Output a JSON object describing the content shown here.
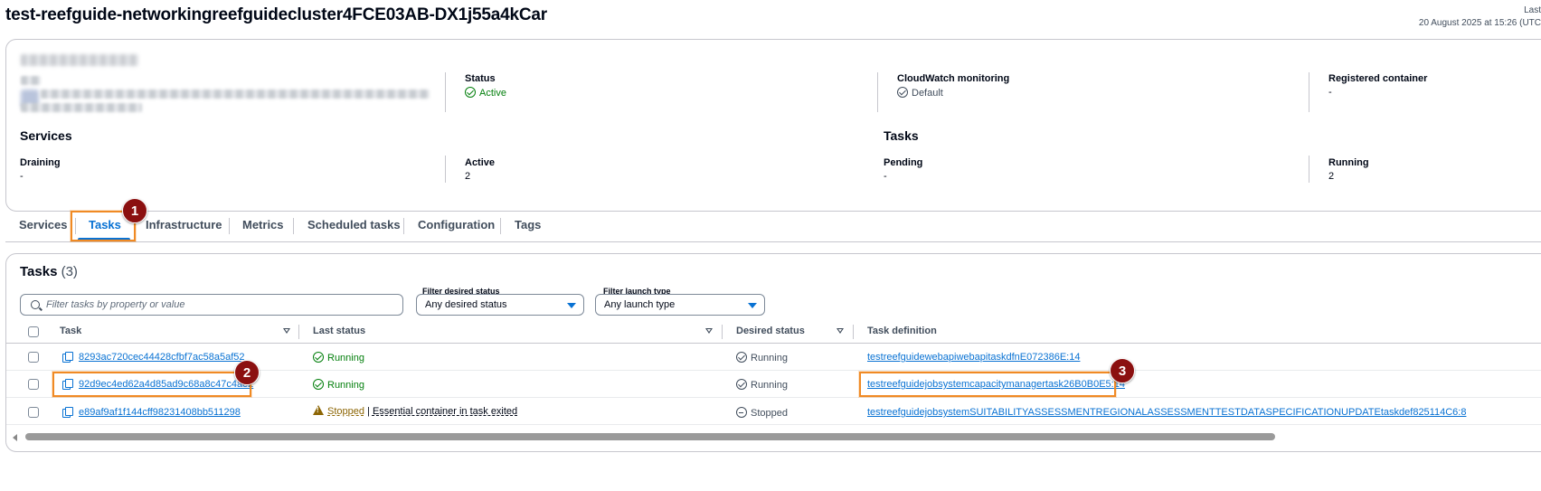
{
  "page": {
    "title": "test-reefguide-networkingreefguidecluster4FCE03AB-DX1j55a4kCar",
    "last_updated_label": "Last",
    "last_updated_value": "20 August 2025 at 15:26 (UTC"
  },
  "overview": {
    "status_label": "Status",
    "status_value": "Active",
    "cloudwatch_label": "CloudWatch monitoring",
    "cloudwatch_value": "Default",
    "registered_label": "Registered container",
    "registered_value": "-",
    "services_heading": "Services",
    "tasks_heading": "Tasks",
    "draining_label": "Draining",
    "draining_value": "-",
    "active_label": "Active",
    "active_value": "2",
    "pending_label": "Pending",
    "pending_value": "-",
    "running_label": "Running",
    "running_value": "2"
  },
  "tabs": [
    "Services",
    "Tasks",
    "Infrastructure",
    "Metrics",
    "Scheduled tasks",
    "Configuration",
    "Tags"
  ],
  "active_tab": "Tasks",
  "tasks_panel": {
    "heading": "Tasks",
    "count": "(3)",
    "search_placeholder": "Filter tasks by property or value",
    "filter_desired_label": "Filter desired status",
    "filter_desired_value": "Any desired status",
    "filter_launch_label": "Filter launch type",
    "filter_launch_value": "Any launch type",
    "columns": [
      "Task",
      "Last status",
      "Desired status",
      "Task definition"
    ],
    "rows": [
      {
        "task": "8293ac720cec44428cfbf7ac58a5af52",
        "last_status": "Running",
        "desired_status": "Running",
        "task_definition": "testreefguidewebapiwebapitaskdfnE072386E:14"
      },
      {
        "task": "92d9ec4ed62a4d85ad9c68a8c47c4ae2",
        "last_status": "Running",
        "desired_status": "Running",
        "task_definition": "testreefguidejobsystemcapacitymanagertask26B0B0E5:14"
      },
      {
        "task": "e89af9af1f144cff98231408bb511298",
        "last_status": "Stopped",
        "last_status_reason": "Essential container in task exited",
        "desired_status": "Stopped",
        "task_definition": "testreefguidejobsystemSUITABILITYASSESSMENTREGIONALASSESSMENTTESTDATASPECIFICATIONUPDATEtaskdef825114C6:8"
      }
    ]
  },
  "annotations": [
    "1",
    "2",
    "3"
  ],
  "colors": {
    "link": "#0972d3",
    "success": "#037f0c",
    "warning": "#8d6605",
    "highlight": "#f08a24",
    "badge": "#8b1010"
  }
}
